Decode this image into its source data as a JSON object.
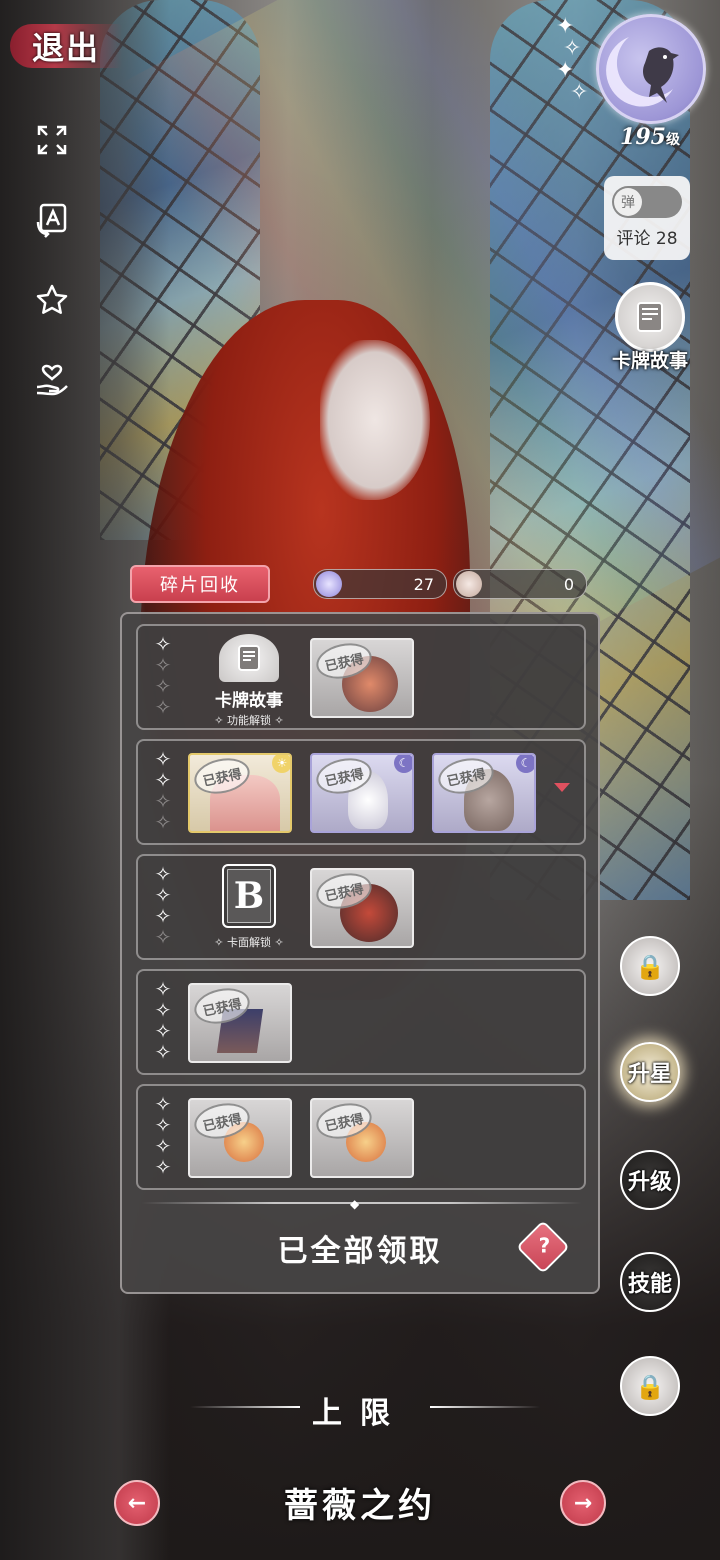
{
  "header": {
    "exit_label": "退出",
    "level": "195",
    "level_unit": "级",
    "danmu_label": "弹",
    "comment_label": "评论 28",
    "card_story_label": "卡牌故事"
  },
  "toolbar": {
    "recycle_label": "碎片回收",
    "currency_1": "27",
    "currency_2": "0"
  },
  "rewards": {
    "stamp_text": "已获得",
    "row1_unlock_title": "卡牌故事",
    "row1_unlock_sub": "✧ 功能解锁 ✧",
    "row3_unlock_letter": "B",
    "row3_unlock_sub": "✧ 卡面解锁 ✧",
    "claimed_label": "已全部领取",
    "help_label": "?"
  },
  "side_buttons": {
    "star_up": "升星",
    "level_up": "升级",
    "skill": "技能"
  },
  "footer": {
    "cap_label": "上限",
    "card_name": "蔷薇之约"
  },
  "colors": {
    "accent_red": "#d44b5a",
    "panel_bg": "#464444",
    "avatar_purple": "#9d96d6"
  },
  "icons": [
    "expand-icon",
    "translate-icon",
    "star-icon",
    "heart-hand-icon",
    "crow-moon-avatar",
    "book-icon",
    "lock-icon",
    "arrow-left-icon",
    "arrow-right-icon"
  ]
}
